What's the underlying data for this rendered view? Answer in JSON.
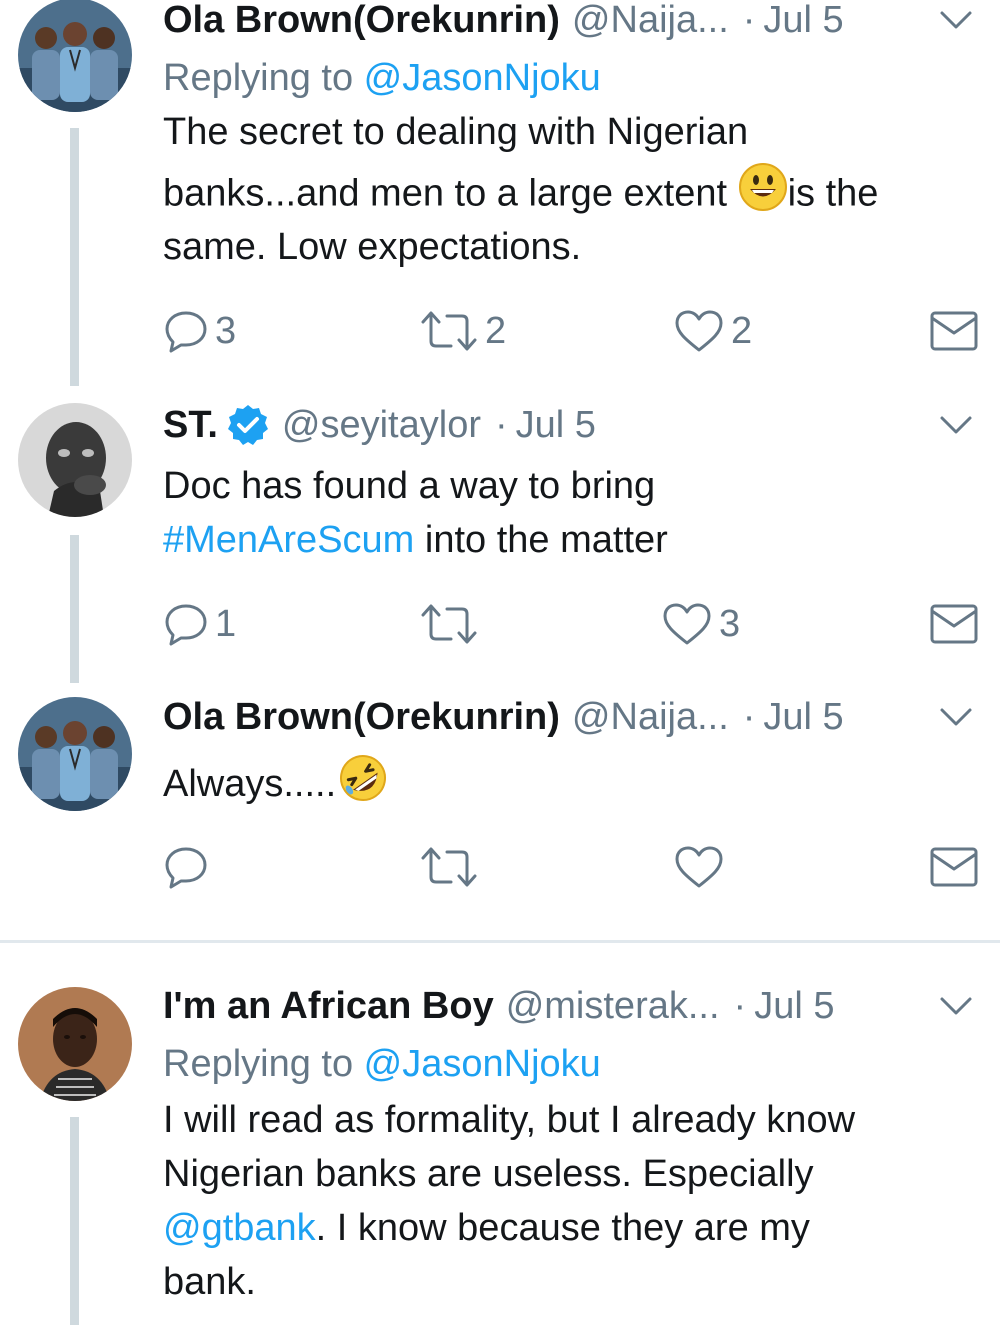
{
  "tweets": [
    {
      "name": "Ola Brown(Orekunrin)",
      "handle": "@Naija...",
      "date": "Jul 5",
      "replying_prefix": "Replying to ",
      "replying_to": "@JasonNjoku",
      "lines": [
        "The secret to dealing with Nigerian",
        "banks...and men to a large extent ",
        "is the",
        "same. Low expectations."
      ],
      "emoji": "smiling-face-emoji",
      "replies": "3",
      "retweets": "2",
      "likes": "2"
    },
    {
      "name": "ST.",
      "verified": true,
      "handle": "@seyitaylor",
      "date": "Jul 5",
      "lines": [
        "Doc has found a way to bring",
        "#MenAreScum",
        " into the matter"
      ],
      "replies": "1",
      "retweets": "",
      "likes": "3"
    },
    {
      "name": "Ola Brown(Orekunrin)",
      "handle": "@Naija...",
      "date": "Jul 5",
      "lines": [
        "Always....."
      ],
      "emoji": "rolling-laughing-emoji",
      "replies": "",
      "retweets": "",
      "likes": ""
    },
    {
      "name": "I'm an African Boy",
      "handle": "@misterak...",
      "date": "Jul 5",
      "replying_prefix": "Replying to ",
      "replying_to": "@JasonNjoku",
      "lines": [
        "I will read as formality, but I already know",
        "Nigerian banks are useless. Especially",
        "@gtbank",
        ". I know because they are my",
        "bank."
      ]
    }
  ],
  "dot": "·",
  "colors": {
    "link": "#1da1f2",
    "secondary": "#657786",
    "thread_line": "#cfd9de",
    "verified": "#1da1f2"
  }
}
